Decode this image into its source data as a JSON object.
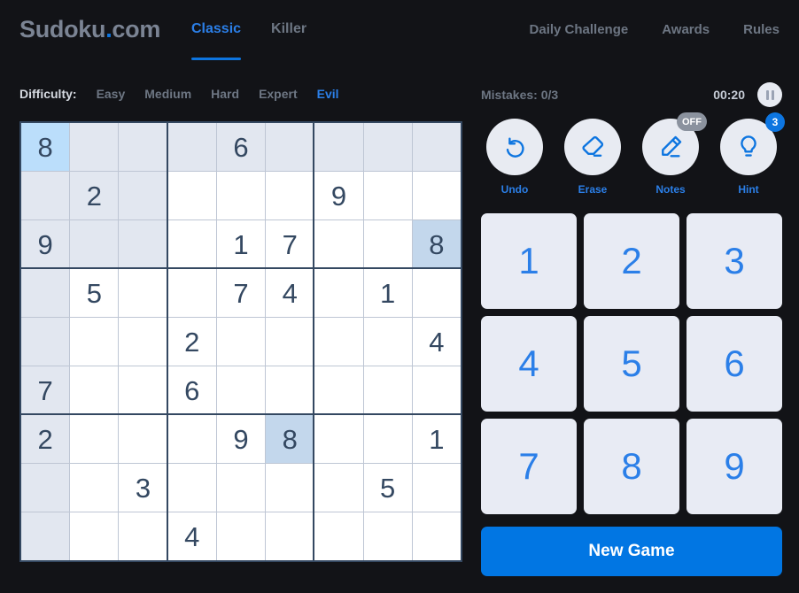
{
  "header": {
    "logo": {
      "name": "Sudoku",
      "dot": ".",
      "tld": "com"
    },
    "tabs": [
      {
        "label": "Classic",
        "active": true
      },
      {
        "label": "Killer",
        "active": false
      }
    ],
    "nav": [
      {
        "label": "Daily Challenge"
      },
      {
        "label": "Awards"
      },
      {
        "label": "Rules"
      }
    ]
  },
  "difficulty": {
    "label": "Difficulty:",
    "options": [
      {
        "label": "Easy",
        "active": false
      },
      {
        "label": "Medium",
        "active": false
      },
      {
        "label": "Hard",
        "active": false
      },
      {
        "label": "Expert",
        "active": false
      },
      {
        "label": "Evil",
        "active": true
      }
    ]
  },
  "status": {
    "mistakes": "Mistakes: 0/3",
    "timer": "00:20",
    "pause_icon": "pause-icon"
  },
  "tools": [
    {
      "label": "Undo",
      "icon": "undo-icon",
      "badge": null
    },
    {
      "label": "Erase",
      "icon": "eraser-icon",
      "badge": null
    },
    {
      "label": "Notes",
      "icon": "pencil-icon",
      "badge": "OFF",
      "badge_type": "off"
    },
    {
      "label": "Hint",
      "icon": "lightbulb-icon",
      "badge": "3",
      "badge_type": "cnt"
    }
  ],
  "numpad": [
    "1",
    "2",
    "3",
    "4",
    "5",
    "6",
    "7",
    "8",
    "9"
  ],
  "new_game_label": "New Game",
  "board": {
    "selected": {
      "row": 0,
      "col": 2
    },
    "selected_value": "8",
    "rows": [
      [
        "8",
        "",
        "",
        "",
        "6",
        "",
        "",
        "",
        ""
      ],
      [
        "",
        "2",
        "",
        "",
        "",
        "",
        "9",
        "",
        ""
      ],
      [
        "9",
        "",
        "",
        "",
        "1",
        "7",
        "",
        "",
        "8"
      ],
      [
        "",
        "5",
        "",
        "",
        "7",
        "4",
        "",
        "1",
        ""
      ],
      [
        "",
        "",
        "",
        "2",
        "",
        "",
        "",
        "",
        "4"
      ],
      [
        "7",
        "",
        "",
        "6",
        "",
        "",
        "",
        "",
        ""
      ],
      [
        "2",
        "",
        "",
        "",
        "9",
        "8",
        "",
        "",
        "1"
      ],
      [
        "",
        "",
        "3",
        "",
        "",
        "",
        "",
        "5",
        ""
      ],
      [
        "",
        "",
        "",
        "4",
        "",
        "",
        "",
        "",
        ""
      ]
    ]
  },
  "colors": {
    "background": "#121317",
    "accent": "#0d75e0",
    "cell_text": "#344861",
    "grid_line": "#bec6d4",
    "grid_border": "#344861",
    "peer_highlight": "#e2e7f0",
    "match_highlight": "#c3d7ec",
    "selected_highlight": "#bbdefb",
    "numpad_bg": "#e8ebf4",
    "new_game_bg": "#0176e3",
    "muted_text": "#6d7683"
  }
}
